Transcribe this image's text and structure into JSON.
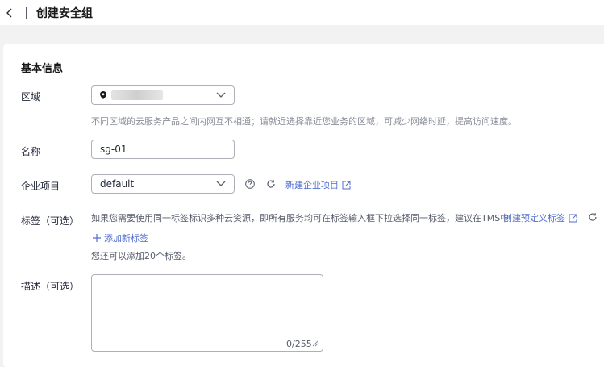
{
  "header": {
    "title": "创建安全组"
  },
  "section": {
    "title": "基本信息"
  },
  "region": {
    "label": "区域",
    "hint": "不同区域的云服务产品之间内网互不相通；请就近选择靠近您业务的区域，可减少网络时延，提高访问速度。"
  },
  "name": {
    "label": "名称",
    "value": "sg-01"
  },
  "project": {
    "label": "企业项目",
    "value": "default",
    "create_link": "新建企业项目"
  },
  "tags": {
    "label": "标签（可选）",
    "hint": "如果您需要使用同一标签标识多种云资源，即所有服务均可在标签输入框下拉选择同一标签，建议在TMS中",
    "predefined_link": "创建预定义标签",
    "add_link": "添加新标签",
    "remaining": "您还可以添加20个标签。"
  },
  "description": {
    "label": "描述（可选）",
    "counter": "0/255"
  },
  "colors": {
    "link": "#526ecc",
    "hint": "#8a8e99",
    "border": "#adb0b8"
  }
}
